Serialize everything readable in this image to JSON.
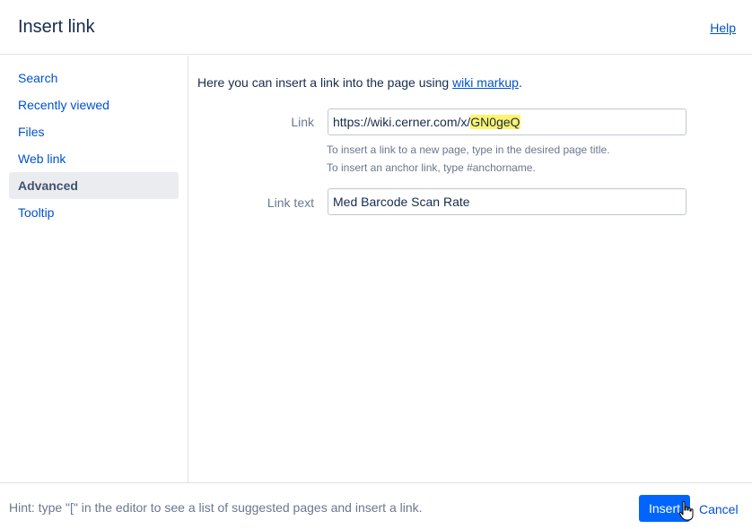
{
  "dialog": {
    "title": "Insert link",
    "help_label": "Help"
  },
  "sidebar": {
    "items": [
      {
        "label": "Search"
      },
      {
        "label": "Recently viewed"
      },
      {
        "label": "Files"
      },
      {
        "label": "Web link"
      },
      {
        "label": "Advanced",
        "active": true
      },
      {
        "label": "Tooltip"
      }
    ]
  },
  "content": {
    "intro_text": "Here you can insert a link into the page using ",
    "intro_link": "wiki markup",
    "intro_end": ".",
    "link": {
      "label": "Link",
      "value_prefix": "https://wiki.cerner.com/x/",
      "value_highlight": "GN0geQ",
      "hint1": "To insert a link to a new page, type in the desired page title.",
      "hint2": "To insert an anchor link, type #anchorname."
    },
    "link_text": {
      "label": "Link text",
      "value": "Med Barcode Scan Rate"
    }
  },
  "footer": {
    "hint": "Hint: type \"[\" in the editor to see a list of suggested pages and insert a link.",
    "insert_label": "Insert",
    "cancel_label": "Cancel"
  },
  "colors": {
    "primary": "#0065ff",
    "link": "#0052cc",
    "highlight": "#fff36b"
  }
}
